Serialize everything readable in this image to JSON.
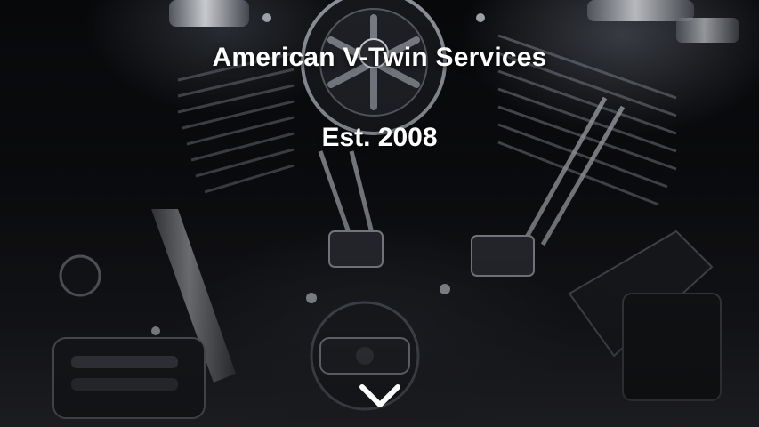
{
  "hero": {
    "title": "American V-Twin Services",
    "subtitle": "Est. 2008",
    "background_image": "motorcycle-v-twin-engine-chrome",
    "scroll_icon": "chevron-down-icon"
  },
  "colors": {
    "text": "#ffffff",
    "background_top": "#07080a",
    "background_bottom": "#2a2b30",
    "chrome": "#c9ccd2"
  }
}
